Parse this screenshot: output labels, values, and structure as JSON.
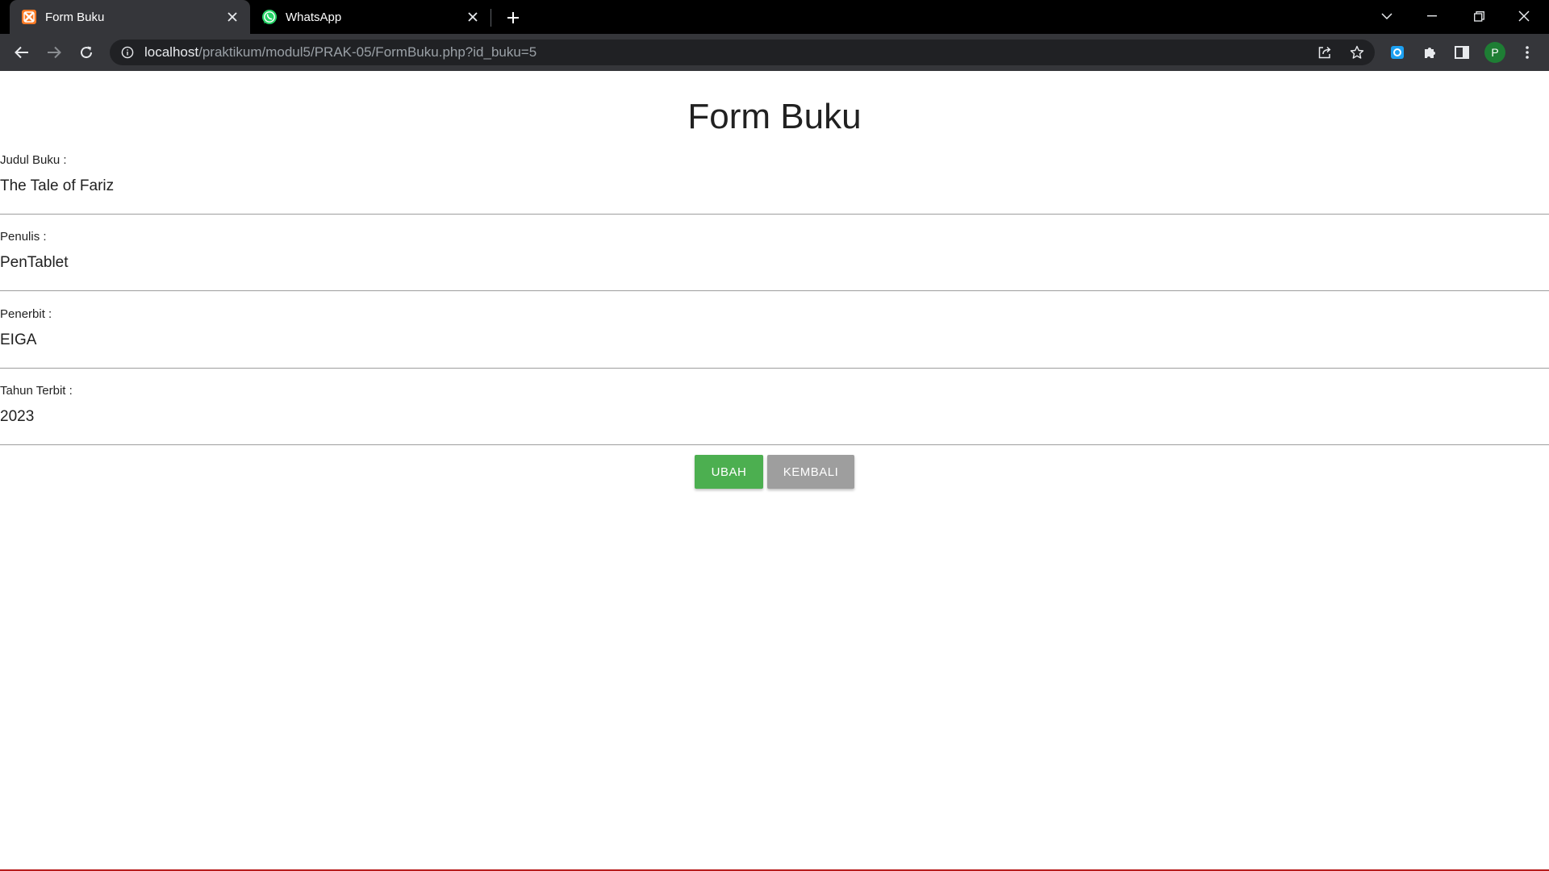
{
  "browser": {
    "tabs": [
      {
        "title": "Form Buku",
        "favicon": "xampp-icon",
        "active": true
      },
      {
        "title": "WhatsApp",
        "favicon": "whatsapp-icon",
        "active": false
      }
    ],
    "address": {
      "host": "localhost",
      "path": "/praktikum/modul5/PRAK-05/FormBuku.php?id_buku=5"
    },
    "profile_initial": "P"
  },
  "page": {
    "title": "Form Buku",
    "fields": [
      {
        "label": "Judul Buku :",
        "value": "The Tale of Fariz"
      },
      {
        "label": "Penulis :",
        "value": "PenTablet"
      },
      {
        "label": "Penerbit :",
        "value": "EIGA"
      },
      {
        "label": "Tahun Terbit :",
        "value": "2023"
      }
    ],
    "buttons": {
      "ubah": "UBAH",
      "kembali": "KEMBALI"
    }
  },
  "colors": {
    "ubah_button": "#4caf50",
    "kembali_button": "#9e9e9e",
    "tab_active": "#35363a",
    "tabstrip": "#000000"
  }
}
